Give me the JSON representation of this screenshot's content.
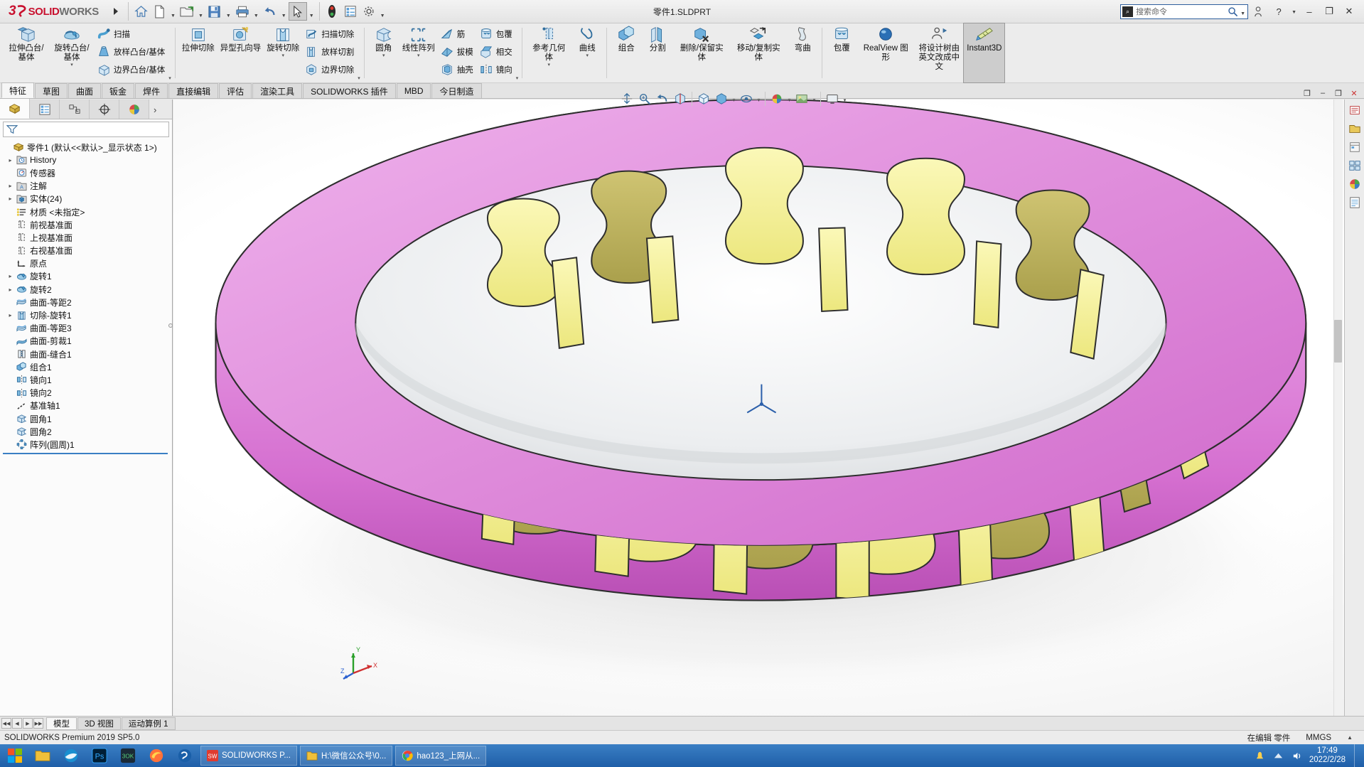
{
  "titlebar": {
    "brand_ds": "3DS",
    "brand_solid": "SOLID",
    "brand_works": "WORKS",
    "document_title": "零件1.SLDPRT",
    "quick_access": [
      {
        "name": "home-icon",
        "label": "主页"
      },
      {
        "name": "new-document-icon",
        "label": "新建"
      },
      {
        "name": "open-folder-icon",
        "label": "打开"
      },
      {
        "name": "save-icon",
        "label": "保存"
      },
      {
        "name": "print-icon",
        "label": "打印"
      },
      {
        "name": "undo-icon",
        "label": "撤销"
      },
      {
        "name": "select-cursor-icon",
        "label": "选择"
      },
      {
        "name": "rebuild-icon",
        "label": "重建模型"
      },
      {
        "name": "options-list-icon",
        "label": "文件属性"
      },
      {
        "name": "gear-icon",
        "label": "选项"
      }
    ],
    "search": {
      "placeholder": "搜索命令",
      "value": ""
    },
    "window_buttons": [
      "–",
      "❐",
      "✕"
    ],
    "help_label": "?",
    "account_label": "登录"
  },
  "ribbon": {
    "groups": [
      {
        "name": "features-primary",
        "big": [
          {
            "label": "拉伸凸台/基体",
            "icon": "extrude-boss-icon",
            "caret": false
          },
          {
            "label": "旋转凸台/基体",
            "icon": "revolve-boss-icon",
            "caret": true
          }
        ],
        "small": [
          {
            "label": "扫描",
            "icon": "sweep-icon"
          },
          {
            "label": "放样凸台/基体",
            "icon": "loft-icon"
          },
          {
            "label": "边界凸台/基体",
            "icon": "boundary-boss-icon"
          }
        ]
      },
      {
        "name": "cut-features",
        "big": [
          {
            "label": "拉伸切除",
            "icon": "extrude-cut-icon",
            "caret": false
          },
          {
            "label": "异型孔向导",
            "icon": "hole-wizard-icon",
            "caret": false
          },
          {
            "label": "旋转切除",
            "icon": "revolve-cut-icon",
            "caret": true
          }
        ],
        "small": [
          {
            "label": "扫描切除",
            "icon": "sweep-cut-icon"
          },
          {
            "label": "放样切割",
            "icon": "loft-cut-icon"
          },
          {
            "label": "边界切除",
            "icon": "boundary-cut-icon"
          }
        ]
      },
      {
        "name": "modify-features",
        "big": [
          {
            "label": "圆角",
            "icon": "fillet-icon",
            "caret": true
          },
          {
            "label": "线性阵列",
            "icon": "linear-pattern-icon",
            "caret": true
          }
        ],
        "small": [
          {
            "label": "筋",
            "icon": "rib-icon"
          },
          {
            "label": "拔模",
            "icon": "draft-icon"
          },
          {
            "label": "抽壳",
            "icon": "shell-icon"
          }
        ],
        "small2": [
          {
            "label": "包覆",
            "icon": "wrap-icon"
          },
          {
            "label": "相交",
            "icon": "intersect-icon"
          },
          {
            "label": "镜向",
            "icon": "mirror-icon"
          }
        ]
      },
      {
        "name": "reference-geometry",
        "big": [
          {
            "label": "参考几何体",
            "icon": "reference-geometry-icon",
            "caret": true
          },
          {
            "label": "曲线",
            "icon": "curves-icon",
            "caret": true
          }
        ]
      },
      {
        "name": "bodies",
        "big": [
          {
            "label": "组合",
            "icon": "combine-icon",
            "caret": false
          },
          {
            "label": "分割",
            "icon": "split-icon",
            "caret": false
          },
          {
            "label": "删除/保留实体",
            "icon": "delete-keep-body-icon",
            "caret": false
          },
          {
            "label": "移动/复制实体",
            "icon": "move-copy-body-icon",
            "caret": false
          },
          {
            "label": "弯曲",
            "icon": "flex-icon",
            "caret": false
          }
        ]
      },
      {
        "name": "display",
        "big": [
          {
            "label": "包覆",
            "icon": "wrap-icon",
            "caret": false
          },
          {
            "label": "RealView 图形",
            "icon": "realview-icon",
            "caret": false
          },
          {
            "label": "将设计树由英文改成中文",
            "icon": "tree-language-icon",
            "caret": false
          },
          {
            "label": "Instant3D",
            "icon": "instant3d-icon",
            "caret": false,
            "active": true
          }
        ]
      }
    ]
  },
  "tabs": [
    {
      "label": "特征",
      "active": true
    },
    {
      "label": "草图",
      "active": false
    },
    {
      "label": "曲面",
      "active": false
    },
    {
      "label": "钣金",
      "active": false
    },
    {
      "label": "焊件",
      "active": false
    },
    {
      "label": "直接编辑",
      "active": false
    },
    {
      "label": "评估",
      "active": false
    },
    {
      "label": "渲染工具",
      "active": false
    },
    {
      "label": "SOLIDWORKS 插件",
      "active": false
    },
    {
      "label": "MBD",
      "active": false
    },
    {
      "label": "今日制造",
      "active": false
    }
  ],
  "view_toolbar": [
    {
      "name": "zoom-to-fit-icon",
      "label": "整屏显示全图"
    },
    {
      "name": "zoom-area-icon",
      "label": "局部放大"
    },
    {
      "name": "previous-view-icon",
      "label": "上一视图"
    },
    {
      "name": "section-view-icon",
      "label": "剖面视图"
    },
    {
      "name": "view-orientation-icon",
      "label": "视图定向"
    },
    {
      "name": "display-style-icon",
      "label": "显示样式"
    },
    {
      "name": "hide-show-items-icon",
      "label": "隐藏/显示项目"
    },
    {
      "name": "edit-appearance-icon",
      "label": "编辑外观"
    },
    {
      "name": "apply-scene-icon",
      "label": "应用布景"
    },
    {
      "name": "view-settings-icon",
      "label": "视图设定"
    }
  ],
  "feature_manager": {
    "tabs": [
      {
        "name": "feature-manager-tab",
        "icon": "feature-tree-icon",
        "active": true
      },
      {
        "name": "property-manager-tab",
        "icon": "property-list-icon",
        "active": false
      },
      {
        "name": "configuration-manager-tab",
        "icon": "configuration-icon",
        "active": false
      },
      {
        "name": "dimxpert-manager-tab",
        "icon": "dimxpert-icon",
        "active": false
      },
      {
        "name": "display-manager-tab",
        "icon": "display-palette-icon",
        "active": false
      }
    ],
    "more_label": "›",
    "filter_placeholder": "",
    "filter_icon": "filter-icon",
    "tree": [
      {
        "label": "零件1  (默认<<默认>_显示状态 1>)",
        "icon": "part-icon",
        "arrow": "",
        "indent": 0
      },
      {
        "label": "History",
        "icon": "history-icon",
        "arrow": "▸",
        "indent": 1
      },
      {
        "label": "传感器",
        "icon": "sensor-icon",
        "arrow": "",
        "indent": 1
      },
      {
        "label": "注解",
        "icon": "annotations-icon",
        "arrow": "▸",
        "indent": 1
      },
      {
        "label": "实体(24)",
        "icon": "solid-bodies-icon",
        "arrow": "▸",
        "indent": 1
      },
      {
        "label": "材质 <未指定>",
        "icon": "material-icon",
        "arrow": "",
        "indent": 1
      },
      {
        "label": "前视基准面",
        "icon": "plane-icon",
        "arrow": "",
        "indent": 1
      },
      {
        "label": "上视基准面",
        "icon": "plane-icon",
        "arrow": "",
        "indent": 1
      },
      {
        "label": "右视基准面",
        "icon": "plane-icon",
        "arrow": "",
        "indent": 1
      },
      {
        "label": "原点",
        "icon": "origin-icon",
        "arrow": "",
        "indent": 1
      },
      {
        "label": "旋转1",
        "icon": "revolve-boss-icon",
        "arrow": "▸",
        "indent": 1
      },
      {
        "label": "旋转2",
        "icon": "revolve-boss-icon",
        "arrow": "▸",
        "indent": 1
      },
      {
        "label": "曲面-等距2",
        "icon": "surface-offset-icon",
        "arrow": "",
        "indent": 1
      },
      {
        "label": "切除-旋转1",
        "icon": "revolve-cut-icon",
        "arrow": "▸",
        "indent": 1
      },
      {
        "label": "曲面-等距3",
        "icon": "surface-offset-icon",
        "arrow": "",
        "indent": 1
      },
      {
        "label": "曲面-剪裁1",
        "icon": "surface-trim-icon",
        "arrow": "",
        "indent": 1
      },
      {
        "label": "曲面-缝合1",
        "icon": "surface-knit-icon",
        "arrow": "",
        "indent": 1
      },
      {
        "label": "组合1",
        "icon": "combine-icon",
        "arrow": "",
        "indent": 1
      },
      {
        "label": "镜向1",
        "icon": "mirror-icon",
        "arrow": "",
        "indent": 1
      },
      {
        "label": "镜向2",
        "icon": "mirror-icon",
        "arrow": "",
        "indent": 1
      },
      {
        "label": "基准轴1",
        "icon": "axis-icon",
        "arrow": "",
        "indent": 1
      },
      {
        "label": "圆角1",
        "icon": "fillet-icon",
        "arrow": "",
        "indent": 1
      },
      {
        "label": "圆角2",
        "icon": "fillet-icon",
        "arrow": "",
        "indent": 1
      },
      {
        "label": "阵列(圆周)1",
        "icon": "circular-pattern-icon",
        "arrow": "",
        "indent": 1
      }
    ]
  },
  "task_pane": [
    {
      "name": "solidworks-resources-icon"
    },
    {
      "name": "design-library-icon"
    },
    {
      "name": "file-explorer-icon"
    },
    {
      "name": "view-palette-icon"
    },
    {
      "name": "appearances-scenes-icon"
    },
    {
      "name": "custom-properties-icon"
    }
  ],
  "graphics": {
    "model_colors": {
      "magenta": "#d973d4",
      "yellow": "#f5f191",
      "olive": "#bdb25a",
      "outline": "#3a3a3a"
    },
    "triad_labels": {
      "x": "X",
      "y": "Y",
      "z": "Z"
    },
    "origin_label": ""
  },
  "bottom_tabs": [
    {
      "label": "模型",
      "active": true
    },
    {
      "label": "3D 视图",
      "active": false
    },
    {
      "label": "运动算例 1",
      "active": false
    }
  ],
  "statusbar": {
    "left": "SOLIDWORKS Premium 2019 SP5.0",
    "editing": "在编辑 零件",
    "units": "MMGS",
    "caret": "▲"
  },
  "taskbar": {
    "start_label": "开始",
    "quick_launch": [
      {
        "name": "file-explorer-taskbar-icon"
      },
      {
        "name": "ie-browser-taskbar-icon"
      },
      {
        "name": "photoshop-taskbar-icon"
      },
      {
        "name": "3dsmax-taskbar-icon"
      },
      {
        "name": "firefox-taskbar-icon"
      },
      {
        "name": "solidworks-launcher-icon"
      }
    ],
    "windows": [
      {
        "label": "SOLIDWORKS P...",
        "icon": "solidworks-window-icon"
      },
      {
        "label": "H:\\微信公众号\\0...",
        "icon": "folder-window-icon"
      },
      {
        "label": "hao123_上网从...",
        "icon": "chrome-window-icon"
      }
    ],
    "tray": [
      {
        "name": "notification-icon"
      },
      {
        "name": "network-icon"
      },
      {
        "name": "volume-icon"
      }
    ],
    "time": "17:49",
    "date": "2022/2/28"
  }
}
